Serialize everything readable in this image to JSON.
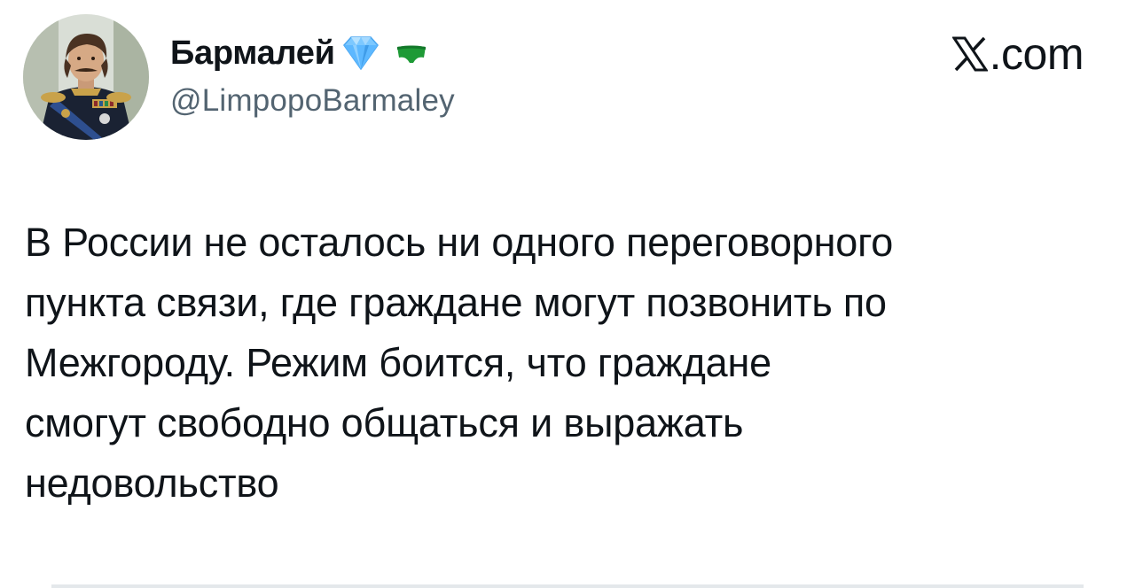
{
  "author": {
    "display_name": "Бармалей",
    "handle": "@LimpopoBarmaley",
    "avatar_icon": "avatar-portrait-uniform",
    "badges": [
      "verified-diamond-icon",
      "green-pants-icon"
    ]
  },
  "site": {
    "label": ".com",
    "logo": "x-logo-icon"
  },
  "tweet": {
    "lines": [
      "В России не осталось ни одного переговорного",
      "пункта связи, где граждане могут позвонить по",
      "Межгороду. Режим боится, что граждане",
      "смогут свободно общаться и выражать",
      "недовольство"
    ]
  },
  "colors": {
    "text": "#0f1419",
    "secondary_text": "#536471",
    "verified_blue": "#5db8ff",
    "pants_green": "#1e9a36",
    "divider": "#e4e8eb"
  }
}
